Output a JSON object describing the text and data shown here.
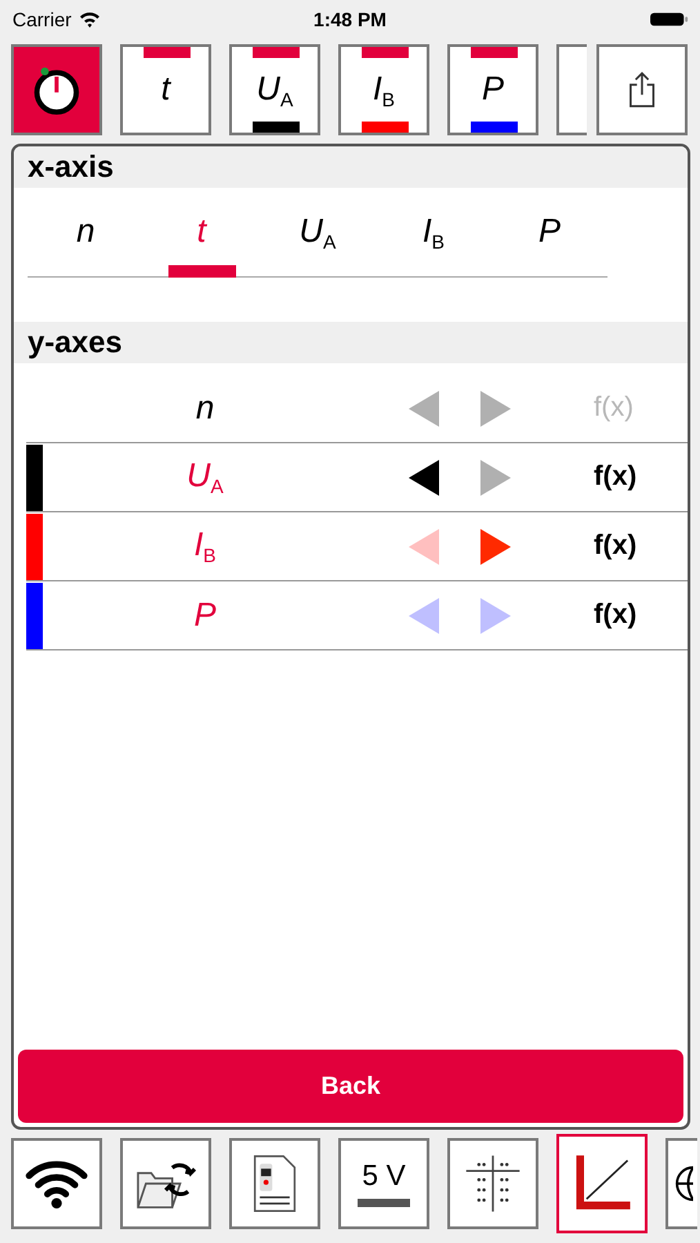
{
  "status_bar": {
    "carrier": "Carrier",
    "time": "1:48 PM"
  },
  "top_toolbar": {
    "timer_selected": true,
    "channels": [
      {
        "symbol": "t",
        "active": true
      },
      {
        "symbol": "U$_{A}$",
        "active": true,
        "color": "#000000"
      },
      {
        "symbol": "I$_{B}$",
        "active": true,
        "color": "#ff0000"
      },
      {
        "symbol": "P",
        "active": true,
        "color": "#0000ff"
      }
    ]
  },
  "x_axis": {
    "title": "x-axis",
    "options": [
      {
        "symbol": "n",
        "selected": false
      },
      {
        "symbol": "t",
        "selected": true
      },
      {
        "symbol": "U$_{A}$",
        "selected": false
      },
      {
        "symbol": "I$_{B}$",
        "selected": false
      },
      {
        "symbol": "P",
        "selected": false
      }
    ]
  },
  "y_axes": {
    "title": "y-axes",
    "rows": [
      {
        "symbol": "n",
        "highlighted": false,
        "fx_enabled": false,
        "fx": "f(x)"
      },
      {
        "symbol": "U$_{A}$",
        "highlighted": true,
        "color": "#000000",
        "left_axis": true,
        "right_axis": false,
        "fx_enabled": true,
        "fx": "f(x)"
      },
      {
        "symbol": "I$_{B}$",
        "highlighted": true,
        "color": "#ff0000",
        "left_axis": false,
        "right_axis": true,
        "fx_enabled": true,
        "fx": "f(x)"
      },
      {
        "symbol": "P",
        "highlighted": true,
        "color": "#0000ff",
        "left_axis": false,
        "right_axis": false,
        "fx_enabled": true,
        "fx": "f(x)"
      }
    ]
  },
  "back_button": "Back",
  "bottom_toolbar": [
    {
      "kind": "wifi",
      "selected": false
    },
    {
      "kind": "folder",
      "selected": false
    },
    {
      "kind": "document",
      "selected": false
    },
    {
      "kind": "voltage",
      "label": "5 V",
      "selected": false
    },
    {
      "kind": "grid",
      "selected": false
    },
    {
      "kind": "chart",
      "selected": true
    },
    {
      "kind": "globe",
      "selected": false
    }
  ]
}
